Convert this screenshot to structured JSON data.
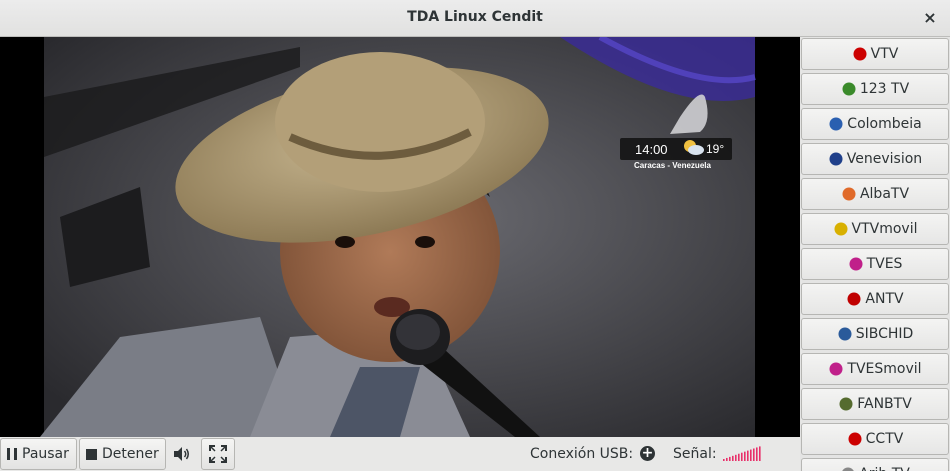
{
  "window": {
    "title": "TDA Linux Cendit",
    "close_glyph": "×"
  },
  "video": {
    "overlay_time": "14:00",
    "overlay_temp": "19°",
    "overlay_location": "Caracas - Venezuela",
    "weather_icon": "partly-cloudy-icon"
  },
  "channels": [
    {
      "label": "VTV",
      "icon": "vtv-logo-icon",
      "color": "#cc0000"
    },
    {
      "label": "123 TV",
      "icon": "123tv-logo-icon",
      "color": "#3a8a2a"
    },
    {
      "label": "Colombeia",
      "icon": "colombeia-logo-icon",
      "color": "#2a5fb0"
    },
    {
      "label": "Venevision",
      "icon": "venevision-logo-icon",
      "color": "#1f3f8a"
    },
    {
      "label": "AlbaTV",
      "icon": "albatv-logo-icon",
      "color": "#e06a2a"
    },
    {
      "label": "VTVmovil",
      "icon": "vtvmovil-logo-icon",
      "color": "#d8b000"
    },
    {
      "label": "TVES",
      "icon": "tves-logo-icon",
      "color": "#c0208a"
    },
    {
      "label": "ANTV",
      "icon": "antv-logo-icon",
      "color": "#c00000"
    },
    {
      "label": "SIBCHID",
      "icon": "sibchid-logo-icon",
      "color": "#2a5a9a"
    },
    {
      "label": "TVESmovil",
      "icon": "tvesmovil-logo-icon",
      "color": "#c0208a"
    },
    {
      "label": "FANBTV",
      "icon": "fanbtv-logo-icon",
      "color": "#556b2f"
    },
    {
      "label": "CCTV",
      "icon": "cctv-logo-icon",
      "color": "#cc0000"
    },
    {
      "label": "Arib TV",
      "icon": "aribtv-logo-icon",
      "color": "#888888"
    }
  ],
  "controls": {
    "pause_label": "Pausar",
    "stop_label": "Detener",
    "usb_label": "Conexión USB:",
    "usb_add_glyph": "+",
    "signal_label": "Señal:",
    "signal_color": "#e8306a"
  }
}
